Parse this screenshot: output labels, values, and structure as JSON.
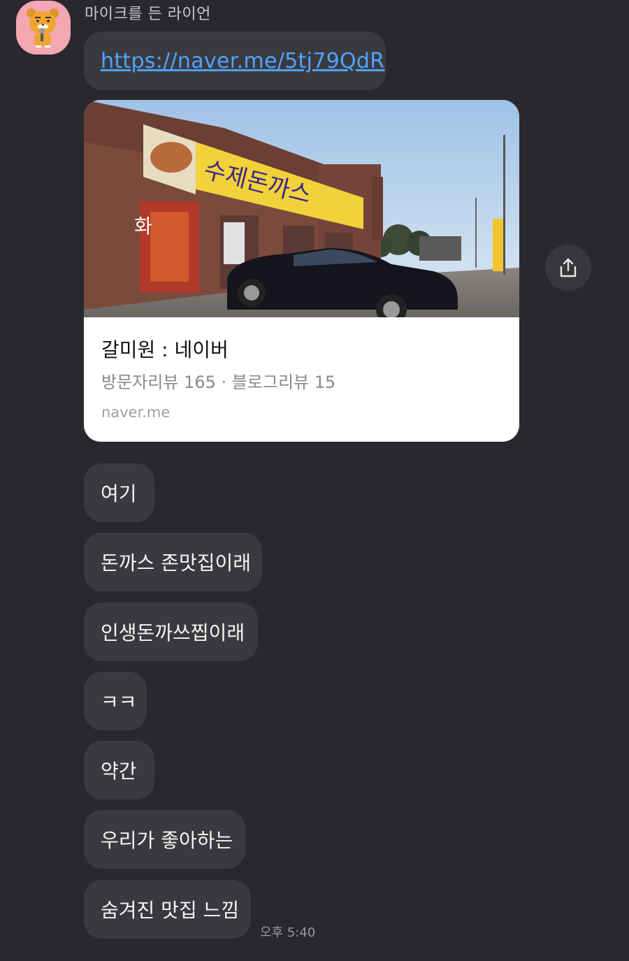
{
  "sender": {
    "name": "마이크를 든 라이언",
    "avatar_icon": "ryan-with-microphone-avatar"
  },
  "messages": {
    "link": "https://naver.me/5tj79QdR",
    "preview": {
      "title": "갈미원 : 네이버",
      "description": "방문자리뷰 165 · 블로그리뷰 15",
      "domain": "naver.me",
      "image_description": "restaurant-storefront-photo"
    },
    "texts": [
      "여기",
      "돈까스 존맛집이래",
      "인생돈까쓰찝이래",
      "ㅋㅋ",
      "약간",
      "우리가 좋아하는",
      "숨겨진 맛집 느낌"
    ],
    "timestamp": "오후 5:40"
  },
  "share_icon": "share-icon",
  "colors": {
    "background": "#29292d",
    "bubble": "#3a3a3e",
    "link": "#4fa3ff",
    "avatar_bg": "#f3a7b2"
  }
}
